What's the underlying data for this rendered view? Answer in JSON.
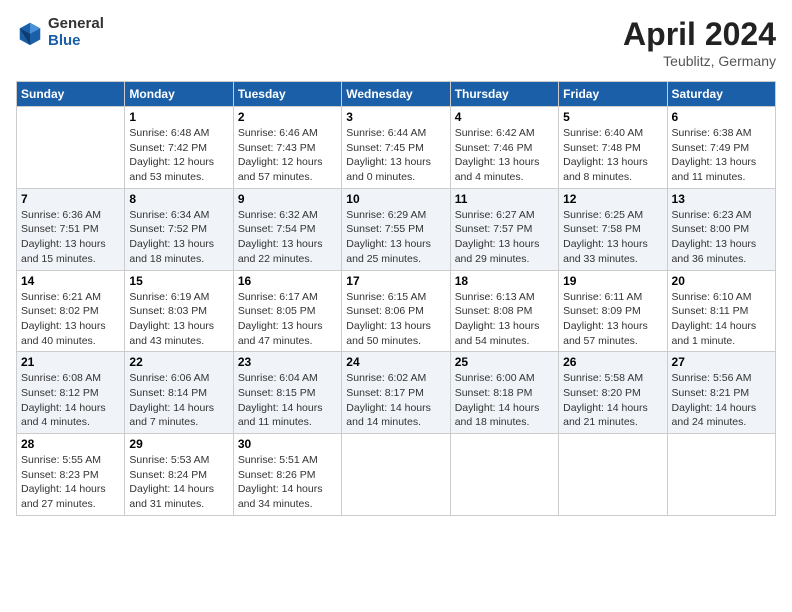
{
  "logo": {
    "general": "General",
    "blue": "Blue"
  },
  "title": "April 2024",
  "location": "Teublitz, Germany",
  "days_header": [
    "Sunday",
    "Monday",
    "Tuesday",
    "Wednesday",
    "Thursday",
    "Friday",
    "Saturday"
  ],
  "weeks": [
    [
      {
        "day": "",
        "sunrise": "",
        "sunset": "",
        "daylight": ""
      },
      {
        "day": "1",
        "sunrise": "Sunrise: 6:48 AM",
        "sunset": "Sunset: 7:42 PM",
        "daylight": "Daylight: 12 hours and 53 minutes."
      },
      {
        "day": "2",
        "sunrise": "Sunrise: 6:46 AM",
        "sunset": "Sunset: 7:43 PM",
        "daylight": "Daylight: 12 hours and 57 minutes."
      },
      {
        "day": "3",
        "sunrise": "Sunrise: 6:44 AM",
        "sunset": "Sunset: 7:45 PM",
        "daylight": "Daylight: 13 hours and 0 minutes."
      },
      {
        "day": "4",
        "sunrise": "Sunrise: 6:42 AM",
        "sunset": "Sunset: 7:46 PM",
        "daylight": "Daylight: 13 hours and 4 minutes."
      },
      {
        "day": "5",
        "sunrise": "Sunrise: 6:40 AM",
        "sunset": "Sunset: 7:48 PM",
        "daylight": "Daylight: 13 hours and 8 minutes."
      },
      {
        "day": "6",
        "sunrise": "Sunrise: 6:38 AM",
        "sunset": "Sunset: 7:49 PM",
        "daylight": "Daylight: 13 hours and 11 minutes."
      }
    ],
    [
      {
        "day": "7",
        "sunrise": "Sunrise: 6:36 AM",
        "sunset": "Sunset: 7:51 PM",
        "daylight": "Daylight: 13 hours and 15 minutes."
      },
      {
        "day": "8",
        "sunrise": "Sunrise: 6:34 AM",
        "sunset": "Sunset: 7:52 PM",
        "daylight": "Daylight: 13 hours and 18 minutes."
      },
      {
        "day": "9",
        "sunrise": "Sunrise: 6:32 AM",
        "sunset": "Sunset: 7:54 PM",
        "daylight": "Daylight: 13 hours and 22 minutes."
      },
      {
        "day": "10",
        "sunrise": "Sunrise: 6:29 AM",
        "sunset": "Sunset: 7:55 PM",
        "daylight": "Daylight: 13 hours and 25 minutes."
      },
      {
        "day": "11",
        "sunrise": "Sunrise: 6:27 AM",
        "sunset": "Sunset: 7:57 PM",
        "daylight": "Daylight: 13 hours and 29 minutes."
      },
      {
        "day": "12",
        "sunrise": "Sunrise: 6:25 AM",
        "sunset": "Sunset: 7:58 PM",
        "daylight": "Daylight: 13 hours and 33 minutes."
      },
      {
        "day": "13",
        "sunrise": "Sunrise: 6:23 AM",
        "sunset": "Sunset: 8:00 PM",
        "daylight": "Daylight: 13 hours and 36 minutes."
      }
    ],
    [
      {
        "day": "14",
        "sunrise": "Sunrise: 6:21 AM",
        "sunset": "Sunset: 8:02 PM",
        "daylight": "Daylight: 13 hours and 40 minutes."
      },
      {
        "day": "15",
        "sunrise": "Sunrise: 6:19 AM",
        "sunset": "Sunset: 8:03 PM",
        "daylight": "Daylight: 13 hours and 43 minutes."
      },
      {
        "day": "16",
        "sunrise": "Sunrise: 6:17 AM",
        "sunset": "Sunset: 8:05 PM",
        "daylight": "Daylight: 13 hours and 47 minutes."
      },
      {
        "day": "17",
        "sunrise": "Sunrise: 6:15 AM",
        "sunset": "Sunset: 8:06 PM",
        "daylight": "Daylight: 13 hours and 50 minutes."
      },
      {
        "day": "18",
        "sunrise": "Sunrise: 6:13 AM",
        "sunset": "Sunset: 8:08 PM",
        "daylight": "Daylight: 13 hours and 54 minutes."
      },
      {
        "day": "19",
        "sunrise": "Sunrise: 6:11 AM",
        "sunset": "Sunset: 8:09 PM",
        "daylight": "Daylight: 13 hours and 57 minutes."
      },
      {
        "day": "20",
        "sunrise": "Sunrise: 6:10 AM",
        "sunset": "Sunset: 8:11 PM",
        "daylight": "Daylight: 14 hours and 1 minute."
      }
    ],
    [
      {
        "day": "21",
        "sunrise": "Sunrise: 6:08 AM",
        "sunset": "Sunset: 8:12 PM",
        "daylight": "Daylight: 14 hours and 4 minutes."
      },
      {
        "day": "22",
        "sunrise": "Sunrise: 6:06 AM",
        "sunset": "Sunset: 8:14 PM",
        "daylight": "Daylight: 14 hours and 7 minutes."
      },
      {
        "day": "23",
        "sunrise": "Sunrise: 6:04 AM",
        "sunset": "Sunset: 8:15 PM",
        "daylight": "Daylight: 14 hours and 11 minutes."
      },
      {
        "day": "24",
        "sunrise": "Sunrise: 6:02 AM",
        "sunset": "Sunset: 8:17 PM",
        "daylight": "Daylight: 14 hours and 14 minutes."
      },
      {
        "day": "25",
        "sunrise": "Sunrise: 6:00 AM",
        "sunset": "Sunset: 8:18 PM",
        "daylight": "Daylight: 14 hours and 18 minutes."
      },
      {
        "day": "26",
        "sunrise": "Sunrise: 5:58 AM",
        "sunset": "Sunset: 8:20 PM",
        "daylight": "Daylight: 14 hours and 21 minutes."
      },
      {
        "day": "27",
        "sunrise": "Sunrise: 5:56 AM",
        "sunset": "Sunset: 8:21 PM",
        "daylight": "Daylight: 14 hours and 24 minutes."
      }
    ],
    [
      {
        "day": "28",
        "sunrise": "Sunrise: 5:55 AM",
        "sunset": "Sunset: 8:23 PM",
        "daylight": "Daylight: 14 hours and 27 minutes."
      },
      {
        "day": "29",
        "sunrise": "Sunrise: 5:53 AM",
        "sunset": "Sunset: 8:24 PM",
        "daylight": "Daylight: 14 hours and 31 minutes."
      },
      {
        "day": "30",
        "sunrise": "Sunrise: 5:51 AM",
        "sunset": "Sunset: 8:26 PM",
        "daylight": "Daylight: 14 hours and 34 minutes."
      },
      {
        "day": "",
        "sunrise": "",
        "sunset": "",
        "daylight": ""
      },
      {
        "day": "",
        "sunrise": "",
        "sunset": "",
        "daylight": ""
      },
      {
        "day": "",
        "sunrise": "",
        "sunset": "",
        "daylight": ""
      },
      {
        "day": "",
        "sunrise": "",
        "sunset": "",
        "daylight": ""
      }
    ]
  ]
}
